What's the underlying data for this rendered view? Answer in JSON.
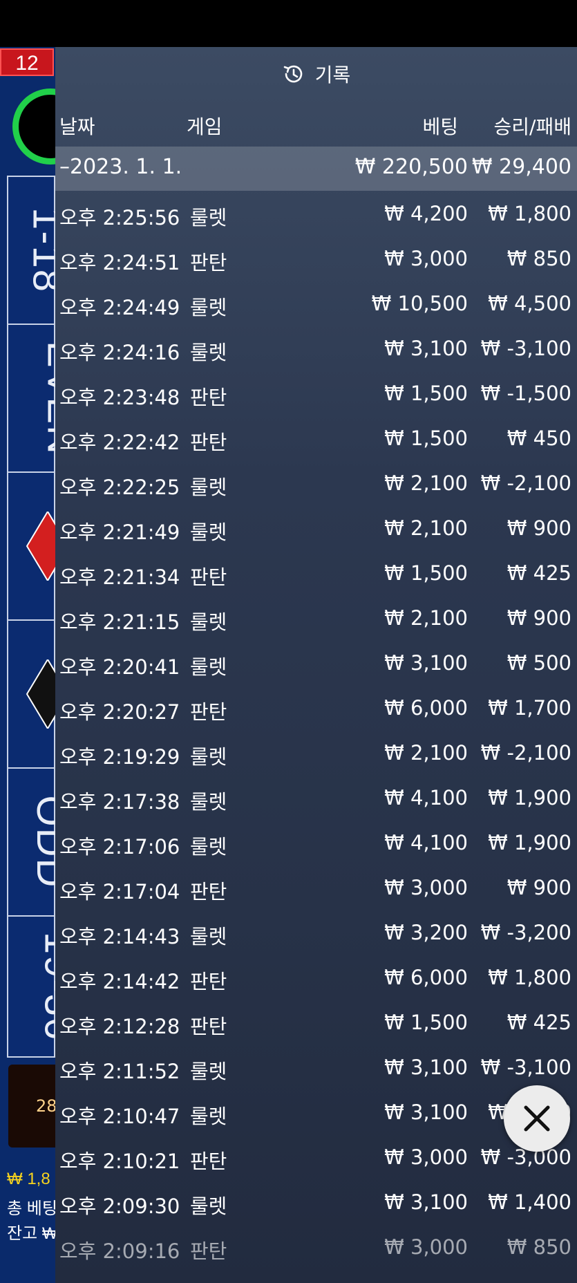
{
  "round_number": "12",
  "board": {
    "strips": [
      "1-18",
      "EVEN",
      "",
      "",
      "ODD",
      "19-36"
    ],
    "wheel_number": "28",
    "balance_line1": "₩ 1,8",
    "balance_line2": "총 베팅",
    "balance_line3": "잔고 ₩"
  },
  "panel": {
    "title": "기록",
    "headers": {
      "date": "날짜",
      "game": "게임",
      "bet": "베팅",
      "win_loss": "승리/패배"
    },
    "summary": {
      "date": "–2023. 1. 1.",
      "bet": "₩ 220,500",
      "win": "₩ 29,400"
    },
    "rows": [
      {
        "time": "오후 2:25:56",
        "game": "룰렛",
        "bet": "₩ 4,200",
        "win": "₩ 1,800"
      },
      {
        "time": "오후 2:24:51",
        "game": "판탄",
        "bet": "₩ 3,000",
        "win": "₩ 850"
      },
      {
        "time": "오후 2:24:49",
        "game": "룰렛",
        "bet": "₩ 10,500",
        "win": "₩ 4,500"
      },
      {
        "time": "오후 2:24:16",
        "game": "룰렛",
        "bet": "₩ 3,100",
        "win": "₩ -3,100"
      },
      {
        "time": "오후 2:23:48",
        "game": "판탄",
        "bet": "₩ 1,500",
        "win": "₩ -1,500"
      },
      {
        "time": "오후 2:22:42",
        "game": "판탄",
        "bet": "₩ 1,500",
        "win": "₩ 450"
      },
      {
        "time": "오후 2:22:25",
        "game": "룰렛",
        "bet": "₩ 2,100",
        "win": "₩ -2,100"
      },
      {
        "time": "오후 2:21:49",
        "game": "룰렛",
        "bet": "₩ 2,100",
        "win": "₩ 900"
      },
      {
        "time": "오후 2:21:34",
        "game": "판탄",
        "bet": "₩ 1,500",
        "win": "₩ 425"
      },
      {
        "time": "오후 2:21:15",
        "game": "룰렛",
        "bet": "₩ 2,100",
        "win": "₩ 900"
      },
      {
        "time": "오후 2:20:41",
        "game": "룰렛",
        "bet": "₩ 3,100",
        "win": "₩ 500"
      },
      {
        "time": "오후 2:20:27",
        "game": "판탄",
        "bet": "₩ 6,000",
        "win": "₩ 1,700"
      },
      {
        "time": "오후 2:19:29",
        "game": "룰렛",
        "bet": "₩ 2,100",
        "win": "₩ -2,100"
      },
      {
        "time": "오후 2:17:38",
        "game": "룰렛",
        "bet": "₩ 4,100",
        "win": "₩ 1,900"
      },
      {
        "time": "오후 2:17:06",
        "game": "룰렛",
        "bet": "₩ 4,100",
        "win": "₩ 1,900"
      },
      {
        "time": "오후 2:17:04",
        "game": "판탄",
        "bet": "₩ 3,000",
        "win": "₩ 900"
      },
      {
        "time": "오후 2:14:43",
        "game": "룰렛",
        "bet": "₩ 3,200",
        "win": "₩ -3,200"
      },
      {
        "time": "오후 2:14:42",
        "game": "판탄",
        "bet": "₩ 6,000",
        "win": "₩ 1,800"
      },
      {
        "time": "오후 2:12:28",
        "game": "판탄",
        "bet": "₩ 1,500",
        "win": "₩ 425"
      },
      {
        "time": "오후 2:11:52",
        "game": "룰렛",
        "bet": "₩ 3,100",
        "win": "₩ -3,100"
      },
      {
        "time": "오후 2:10:47",
        "game": "룰렛",
        "bet": "₩ 3,100",
        "win": "₩ 1,400"
      },
      {
        "time": "오후 2:10:21",
        "game": "판탄",
        "bet": "₩ 3,000",
        "win": "₩ -3,000"
      },
      {
        "time": "오후 2:09:30",
        "game": "룰렛",
        "bet": "₩ 3,100",
        "win": "₩ 1,400"
      },
      {
        "time": "오후 2:09:16",
        "game": "판탄",
        "bet": "₩ 3,000",
        "win": "₩ 850"
      }
    ]
  },
  "icons": {
    "history": "history-clock-icon",
    "close": "close-icon"
  },
  "colors": {
    "badge": "#c8161d",
    "timer": "#21d04a",
    "board": "#0a2a6b",
    "panel": "#2c3850",
    "balance": "#f6d31e"
  }
}
